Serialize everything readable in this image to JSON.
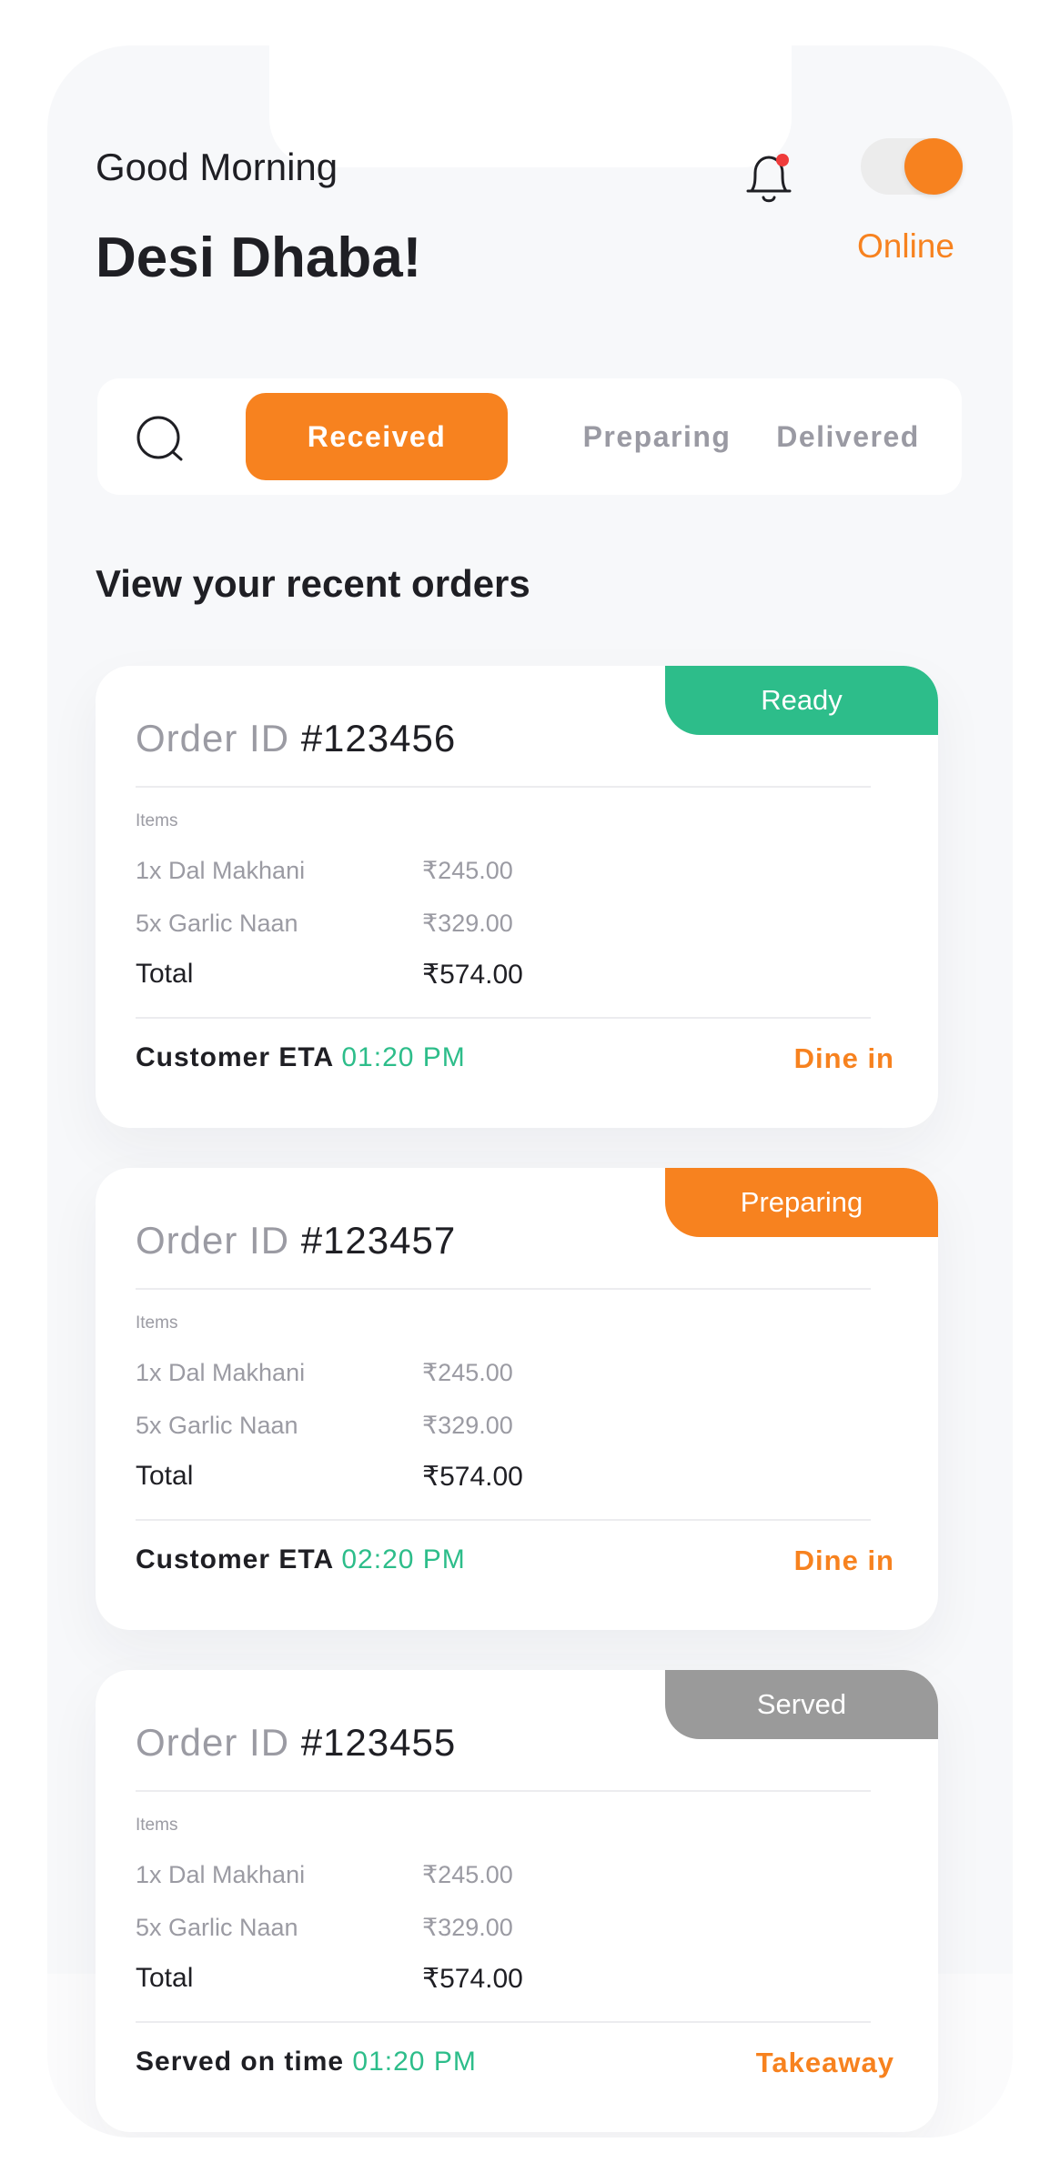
{
  "header": {
    "greeting": "Good Morning",
    "restaurant_name": "Desi Dhaba!",
    "status_label": "Online",
    "online": true
  },
  "tabs": [
    {
      "label": "Received",
      "active": true
    },
    {
      "label": "Preparing",
      "active": false
    },
    {
      "label": "Delivered",
      "active": false
    }
  ],
  "section_title": "View your recent orders",
  "colors": {
    "accent": "#f7821f",
    "ready": "#2dbd8a",
    "served": "#9a9a9a",
    "time": "#2dbd8a"
  },
  "orders": [
    {
      "badge": "Ready",
      "id_label": "Order ID",
      "id": "#123456",
      "items_label": "Items",
      "items": [
        {
          "name": "1x Dal Makhani",
          "price": "₹245.00"
        },
        {
          "name": "5x Garlic Naan",
          "price": "₹329.00"
        }
      ],
      "total_label": "Total",
      "total": "₹574.00",
      "footer_label": "Customer ETA",
      "footer_time": "01:20 PM",
      "service": "Dine in"
    },
    {
      "badge": "Preparing",
      "id_label": "Order ID",
      "id": "#123457",
      "items_label": "Items",
      "items": [
        {
          "name": "1x Dal Makhani",
          "price": "₹245.00"
        },
        {
          "name": "5x Garlic Naan",
          "price": "₹329.00"
        }
      ],
      "total_label": "Total",
      "total": "₹574.00",
      "footer_label": "Customer ETA",
      "footer_time": "02:20 PM",
      "service": "Dine in"
    },
    {
      "badge": "Served",
      "id_label": "Order ID",
      "id": "#123455",
      "items_label": "Items",
      "items": [
        {
          "name": "1x Dal Makhani",
          "price": "₹245.00"
        },
        {
          "name": "5x Garlic Naan",
          "price": "₹329.00"
        }
      ],
      "total_label": "Total",
      "total": "₹574.00",
      "footer_label": "Served on time",
      "footer_time": "01:20 PM",
      "service": "Takeaway"
    }
  ]
}
